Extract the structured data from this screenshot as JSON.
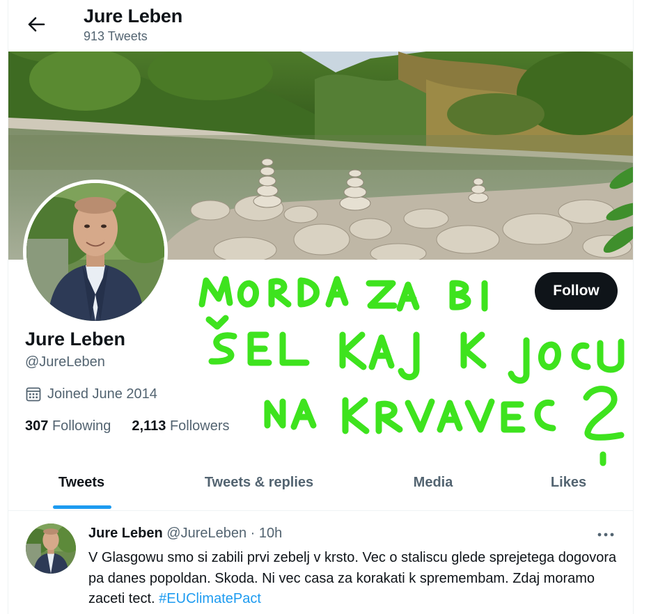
{
  "header": {
    "name": "Jure Leben",
    "tweet_count": "913 Tweets"
  },
  "profile": {
    "name": "Jure Leben",
    "handle": "@JureLeben",
    "joined": "Joined June 2014",
    "following_count": "307",
    "following_label": "Following",
    "followers_count": "2,113",
    "followers_label": "Followers",
    "follow_label": "Follow"
  },
  "annotation": {
    "lines": [
      "MORDA ZA BI",
      "ŠEL KAJ K JOCU",
      "NA KRVAVEC ?"
    ],
    "color": "#3ee31e"
  },
  "tabs": [
    {
      "label": "Tweets",
      "active": true
    },
    {
      "label": "Tweets & replies",
      "active": false
    },
    {
      "label": "Media",
      "active": false
    },
    {
      "label": "Likes",
      "active": false
    }
  ],
  "tweet": {
    "name": "Jure Leben",
    "handle": "@JureLeben",
    "separator": "·",
    "time": "10h",
    "text": "V Glasgowu smo si zabili prvi zebelj v krsto. Vec o staliscu glede sprejetega dogovora pa danes popoldan. Skoda. Ni vec casa za korakati k spremembam. Zdaj moramo zaceti tect.",
    "hashtag": "#EUClimatePact"
  },
  "icons": {
    "back": "arrow-left-icon",
    "calendar": "calendar-icon",
    "more": "more-horizontal-icon"
  },
  "colors": {
    "accent": "#1d9bf0",
    "text": "#0f1419",
    "muted": "#536471",
    "follow_bg": "#0f1419"
  }
}
